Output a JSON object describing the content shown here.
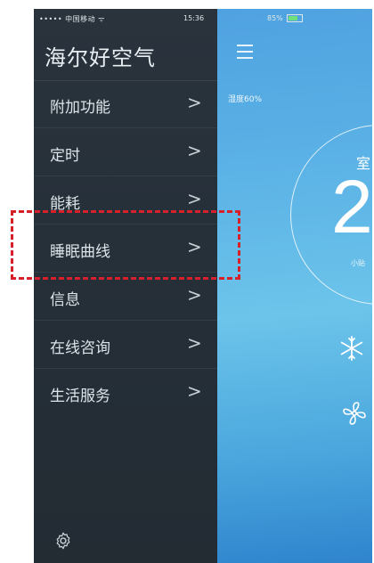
{
  "status_bar": {
    "carrier": "••••• 中国移动 ᯤ",
    "time": "15:36",
    "battery": "85%"
  },
  "drawer": {
    "title": "海尔好空气",
    "items": [
      {
        "label": "附加功能",
        "arrow": ">"
      },
      {
        "label": "定时",
        "arrow": ">"
      },
      {
        "label": "能耗",
        "arrow": ">"
      },
      {
        "label": "睡眠曲线",
        "arrow": ">"
      },
      {
        "label": "信息",
        "arrow": ">"
      },
      {
        "label": "在线咨询",
        "arrow": ">"
      },
      {
        "label": "生活服务",
        "arrow": ">"
      }
    ],
    "highlighted_item": "睡眠曲线"
  },
  "main": {
    "humidity": "湿度60%",
    "room_label": "室",
    "temperature_partial": "2",
    "small_label": "小贴"
  },
  "icons": {
    "settings": "gear-icon",
    "menu": "hamburger-icon",
    "cool_mode": "snowflake-icon",
    "fan_mode": "fan-icon"
  },
  "colors": {
    "drawer_bg": "#263039",
    "main_bg": "#5cb3e6",
    "highlight": "#d8202a"
  }
}
